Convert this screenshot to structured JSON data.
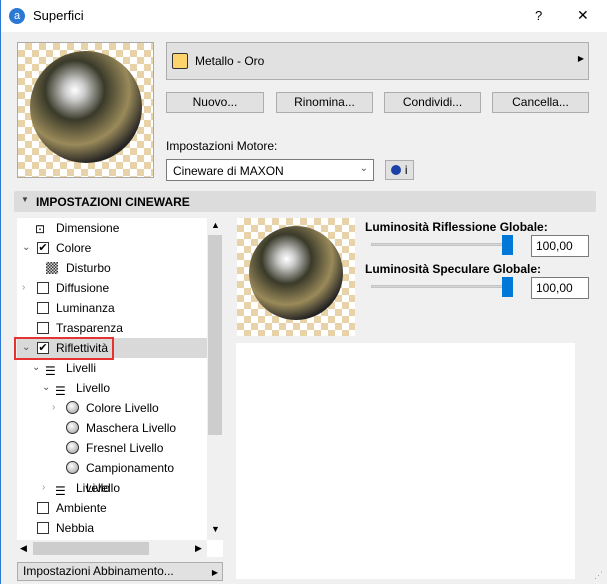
{
  "window": {
    "title": "Superfici",
    "help": "?",
    "close": "✕"
  },
  "material": {
    "name": "Metallo - Oro",
    "swatch_color": "#fdd36e"
  },
  "buttons": {
    "new": "Nuovo...",
    "rename": "Rinomina...",
    "share": "Condividi...",
    "delete": "Cancella..."
  },
  "engine": {
    "label": "Impostazioni Motore:",
    "value": "Cineware di MAXON",
    "info": "i"
  },
  "section": {
    "title": "IMPOSTAZIONI CINEWARE"
  },
  "tree": [
    {
      "label": "Dimensione"
    },
    {
      "label": "Colore",
      "checked": true
    },
    {
      "label": "Disturbo"
    },
    {
      "label": "Diffusione",
      "checked": false
    },
    {
      "label": "Luminanza",
      "checked": false
    },
    {
      "label": "Trasparenza",
      "checked": false
    },
    {
      "label": "Riflettività",
      "checked": true,
      "selected": true
    },
    {
      "label": "Livelli"
    },
    {
      "label": "Livello"
    },
    {
      "label": "Colore Livello"
    },
    {
      "label": "Maschera Livello"
    },
    {
      "label": "Fresnel Livello"
    },
    {
      "label": "Campionamento Livello"
    },
    {
      "label": "Livello"
    },
    {
      "label": "Ambiente",
      "checked": false
    },
    {
      "label": "Nebbia",
      "checked": false
    }
  ],
  "params": {
    "reflection_label": "Luminosità Riflessione Globale:",
    "reflection_value": "100,00",
    "reflection_pct": 100,
    "specular_label": "Luminosità Speculare Globale:",
    "specular_value": "100,00",
    "specular_pct": 100
  },
  "matching_button": "Impostazioni Abbinamento..."
}
